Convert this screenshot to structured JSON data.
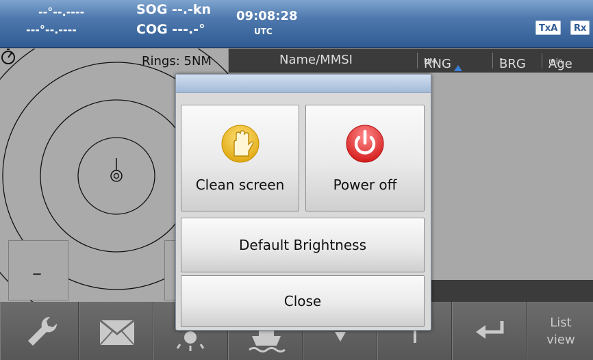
{
  "status": {
    "lat": "--°--.----",
    "lon": "---°--.----",
    "sog": "SOG --.-kn",
    "cog": "COG ---.-°",
    "time": "09:08:28",
    "timezone": "UTC",
    "tx_badge": "TxA",
    "rx_badge": "Rx"
  },
  "radar": {
    "rings_label": "Rings: 5NM",
    "zoom_out_label": "–",
    "north_icon": "compass-north-icon"
  },
  "target_list": {
    "columns": {
      "name": "Name/MMSI",
      "range": "RNG",
      "range_unit": "NM",
      "bearing": "BRG",
      "bearing_unit": "°",
      "age": "Age",
      "age_unit": "min"
    },
    "sort_indicator": "sort-up-icon"
  },
  "modal": {
    "clean_screen_label": "Clean screen",
    "power_off_label": "Power off",
    "default_brightness_label": "Default Brightness",
    "close_label": "Close",
    "clean_icon": "glove-icon",
    "power_icon": "power-icon"
  },
  "toolbar": {
    "list_view_label": "List\nview",
    "buttons": [
      "wrench-icon",
      "message-icon",
      "brightness-icon",
      "ship-icon",
      "down-arrow-icon",
      "up-arrow-icon",
      "enter-icon"
    ]
  },
  "colors": {
    "status_bar": "#4f79ae",
    "power_red": "#e23b3b",
    "glove_yellow": "#f2c12e",
    "sort_blue": "#3a7ed6"
  }
}
